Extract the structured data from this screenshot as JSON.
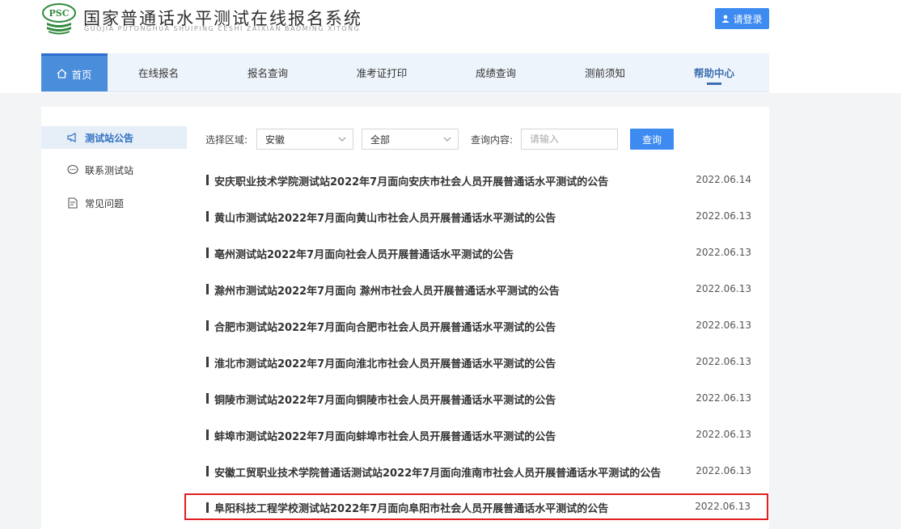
{
  "header": {
    "logo_text": "PSC",
    "title": "国家普通话水平测试在线报名系统",
    "subtitle": "GUOJIA PUTONGHUA SHUIPING CESHI ZAIXIAN BAOMING XITONG",
    "login_label": "请登录",
    "colors": {
      "accent": "#3d8bf0",
      "logo_green": "#2f8a3c"
    }
  },
  "nav": {
    "items": [
      {
        "label": "首页",
        "icon": "home-icon"
      },
      {
        "label": "在线报名"
      },
      {
        "label": "报名查询"
      },
      {
        "label": "准考证打印"
      },
      {
        "label": "成绩查询"
      },
      {
        "label": "测前须知"
      },
      {
        "label": "帮助中心"
      }
    ],
    "active": "帮助中心"
  },
  "sidebar": {
    "items": [
      {
        "label": "测试站公告",
        "icon": "megaphone-icon",
        "active": true
      },
      {
        "label": "联系测试站",
        "icon": "chat-icon"
      },
      {
        "label": "常见问题",
        "icon": "document-icon"
      }
    ]
  },
  "filter": {
    "region_label": "选择区域:",
    "province_value": "安徽",
    "city_value": "全部",
    "query_label": "查询内容:",
    "query_placeholder": "请输入",
    "query_button": "查询"
  },
  "notices": [
    {
      "title": "安庆职业技术学院测试站2022年7月面向安庆市社会人员开展普通话水平测试的公告",
      "date": "2022.06.14"
    },
    {
      "title": "黄山市测试站2022年7月面向黄山市社会人员开展普通话水平测试的公告",
      "date": "2022.06.13"
    },
    {
      "title": "亳州测试站2022年7月面向社会人员开展普通话水平测试的公告",
      "date": "2022.06.13"
    },
    {
      "title": "滁州市测试站2022年7月面向 滁州市社会人员开展普通话水平测试的公告",
      "date": "2022.06.13"
    },
    {
      "title": "合肥市测试站2022年7月面向合肥市社会人员开展普通话水平测试的公告",
      "date": "2022.06.13"
    },
    {
      "title": "淮北市测试站2022年7月面向淮北市社会人员开展普通话水平测试的公告",
      "date": "2022.06.13"
    },
    {
      "title": "铜陵市测试站2022年7月面向铜陵市社会人员开展普通话水平测试的公告",
      "date": "2022.06.13"
    },
    {
      "title": "蚌埠市测试站2022年7月面向蚌埠市社会人员开展普通话水平测试的公告",
      "date": "2022.06.13"
    },
    {
      "title": "安徽工贸职业技术学院普通话测试站2022年7月面向淮南市社会人员开展普通话水平测试的公告",
      "date": "2022.06.13"
    },
    {
      "title": "阜阳科技工程学校测试站2022年7月面向阜阳市社会人员开展普通话水平测试的公告",
      "date": "2022.06.13",
      "highlighted": true
    }
  ]
}
